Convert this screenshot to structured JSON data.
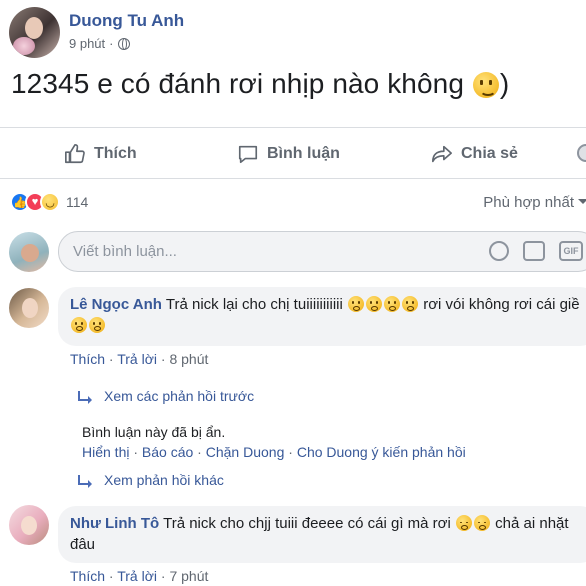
{
  "post": {
    "author": "Duong Tu Anh",
    "time": "9 phút",
    "text": "12345 e có đánh rơi nhịp nào không",
    "text_tail": ")"
  },
  "actions": {
    "like": "Thích",
    "comment": "Bình luận",
    "share": "Chia sẻ"
  },
  "reactions": {
    "count": "114",
    "types": [
      "like-icon",
      "love-icon",
      "haha-icon"
    ]
  },
  "filter": "Phù hợp nhất",
  "comment_box": {
    "placeholder": "Viết bình luận..."
  },
  "comments": [
    {
      "author": "Lê Ngọc Anh",
      "text_a": "Trả nick lại cho chị tuiiiiiiiiiii",
      "text_b": "rơi vói không rơi cái giề",
      "like": "Thích",
      "reply": "Trả lời",
      "time": "8 phút"
    },
    {
      "author": "Như Linh Tô",
      "text_a": "Trả nick cho chjj tuiii đeeee có cái gì mà rơi",
      "text_b": "chả ai nhặt đâu",
      "like": "Thích",
      "reply": "Trả lời",
      "time": "7 phút"
    }
  ],
  "replies": {
    "previous": "Xem các phản hồi trước",
    "hidden_note": "Bình luận này đã bị ẩn.",
    "hidden_links": [
      "Hiển thị",
      "Báo cáo",
      "Chặn Duong",
      "Cho Duong ý kiến phản hồi"
    ],
    "more": "Xem phản hồi khác"
  },
  "separators": {
    "dot": " · "
  }
}
